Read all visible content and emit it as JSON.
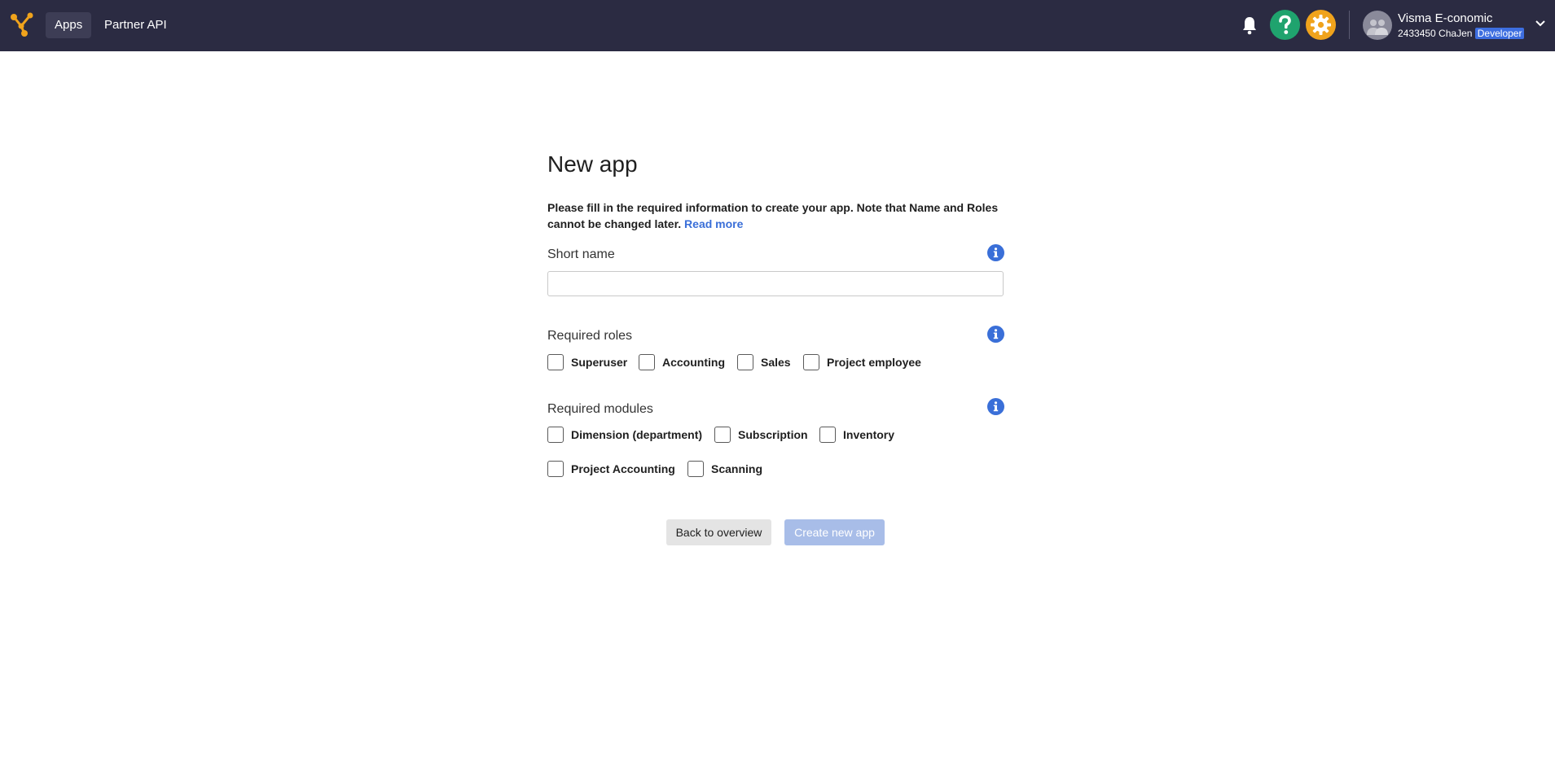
{
  "topbar": {
    "nav": [
      "Apps",
      "Partner API"
    ],
    "user": {
      "name": "Visma E-conomic",
      "account": "2433450 ChaJen",
      "role_badge": "Developer"
    },
    "icons": [
      "logo-icon",
      "bell-icon",
      "help-icon",
      "gear-icon",
      "avatar-icon",
      "chevron-down-icon"
    ],
    "colors": {
      "bar": "#2b2b42",
      "help": "#1fa36e",
      "settings": "#f0a31c",
      "accent": "#3a6fd8"
    }
  },
  "form": {
    "title": "New app",
    "intro": "Please fill in the required information to create your app. Note that Name and Roles cannot be changed later.",
    "read_more": "Read more",
    "short_name": {
      "label": "Short name",
      "value": "",
      "placeholder": ""
    },
    "roles": {
      "label": "Required roles",
      "options": [
        {
          "label": "Superuser",
          "checked": false
        },
        {
          "label": "Accounting",
          "checked": false
        },
        {
          "label": "Sales",
          "checked": false
        },
        {
          "label": "Project employee",
          "checked": false
        }
      ]
    },
    "modules": {
      "label": "Required modules",
      "options": [
        {
          "label": "Dimension (department)",
          "checked": false
        },
        {
          "label": "Subscription",
          "checked": false
        },
        {
          "label": "Inventory",
          "checked": false
        },
        {
          "label": "Project Accounting",
          "checked": false
        },
        {
          "label": "Scanning",
          "checked": false
        }
      ]
    }
  },
  "actions": {
    "back": "Back to overview",
    "create": "Create new app"
  }
}
